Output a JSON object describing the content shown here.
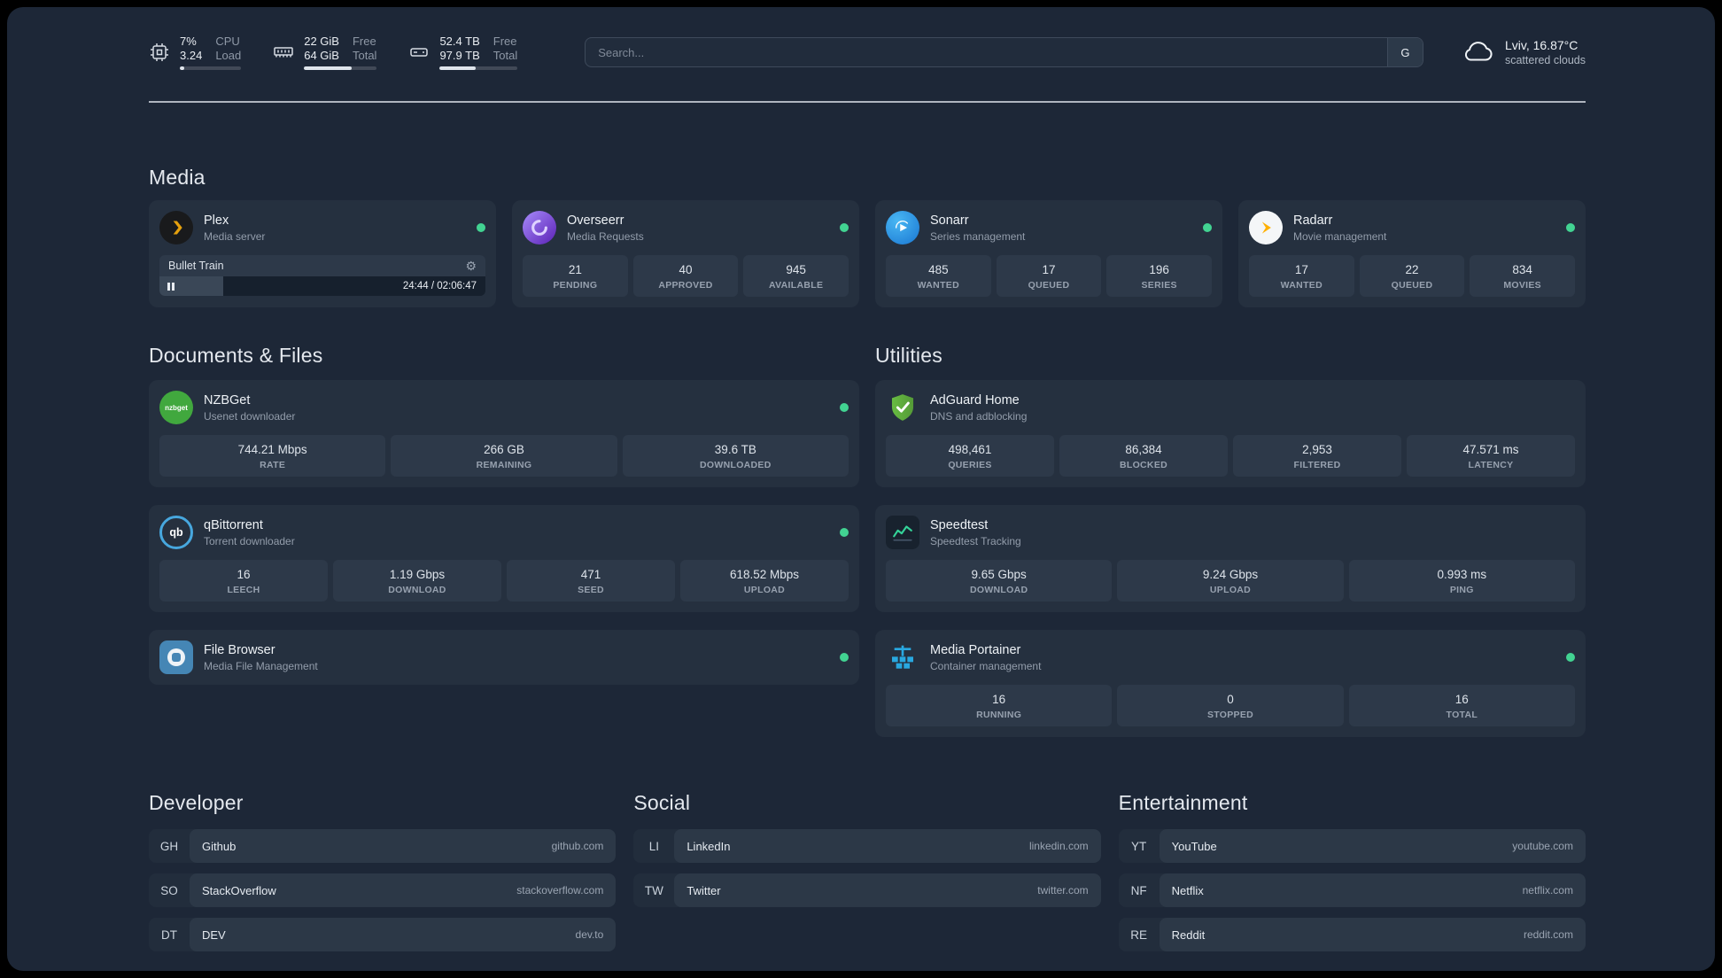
{
  "topbar": {
    "cpu": {
      "value_top": "7%",
      "value_bottom": "3.24",
      "label_top": "CPU",
      "label_bottom": "Load",
      "progress_percent": 7
    },
    "memory": {
      "value_top": "22 GiB",
      "value_bottom": "64 GiB",
      "label_top": "Free",
      "label_bottom": "Total",
      "progress_percent": 66
    },
    "disk": {
      "value_top": "52.4 TB",
      "value_bottom": "97.9 TB",
      "label_top": "Free",
      "label_bottom": "Total",
      "progress_percent": 46
    },
    "search": {
      "placeholder": "Search...",
      "provider_button": "G"
    },
    "weather": {
      "location": "Lviv, 16.87°C",
      "condition": "scattered clouds"
    }
  },
  "media": {
    "title": "Media",
    "plex": {
      "name": "Plex",
      "description": "Media server",
      "now_playing_title": "Bullet Train",
      "now_playing_time": "24:44 / 02:06:47",
      "progress_percent": 19.5
    },
    "overseerr": {
      "name": "Overseerr",
      "description": "Media Requests",
      "stats": [
        {
          "value": "21",
          "label": "PENDING"
        },
        {
          "value": "40",
          "label": "APPROVED"
        },
        {
          "value": "945",
          "label": "AVAILABLE"
        }
      ]
    },
    "sonarr": {
      "name": "Sonarr",
      "description": "Series management",
      "stats": [
        {
          "value": "485",
          "label": "WANTED"
        },
        {
          "value": "17",
          "label": "QUEUED"
        },
        {
          "value": "196",
          "label": "SERIES"
        }
      ]
    },
    "radarr": {
      "name": "Radarr",
      "description": "Movie management",
      "stats": [
        {
          "value": "17",
          "label": "WANTED"
        },
        {
          "value": "22",
          "label": "QUEUED"
        },
        {
          "value": "834",
          "label": "MOVIES"
        }
      ]
    }
  },
  "documents": {
    "title": "Documents & Files",
    "nzbget": {
      "name": "NZBGet",
      "description": "Usenet downloader",
      "icon_text": "nzbget",
      "stats": [
        {
          "value": "744.21 Mbps",
          "label": "RATE"
        },
        {
          "value": "266 GB",
          "label": "REMAINING"
        },
        {
          "value": "39.6 TB",
          "label": "DOWNLOADED"
        }
      ]
    },
    "qbittorrent": {
      "name": "qBittorrent",
      "description": "Torrent downloader",
      "icon_text": "qb",
      "stats": [
        {
          "value": "16",
          "label": "LEECH"
        },
        {
          "value": "1.19 Gbps",
          "label": "DOWNLOAD"
        },
        {
          "value": "471",
          "label": "SEED"
        },
        {
          "value": "618.52 Mbps",
          "label": "UPLOAD"
        }
      ]
    },
    "filebrowser": {
      "name": "File Browser",
      "description": "Media File Management"
    }
  },
  "utilities": {
    "title": "Utilities",
    "adguard": {
      "name": "AdGuard Home",
      "description": "DNS and adblocking",
      "stats": [
        {
          "value": "498,461",
          "label": "QUERIES"
        },
        {
          "value": "86,384",
          "label": "BLOCKED"
        },
        {
          "value": "2,953",
          "label": "FILTERED"
        },
        {
          "value": "47.571 ms",
          "label": "LATENCY"
        }
      ]
    },
    "speedtest": {
      "name": "Speedtest",
      "description": "Speedtest Tracking",
      "stats": [
        {
          "value": "9.65 Gbps",
          "label": "DOWNLOAD"
        },
        {
          "value": "9.24 Gbps",
          "label": "UPLOAD"
        },
        {
          "value": "0.993 ms",
          "label": "PING"
        }
      ]
    },
    "portainer": {
      "name": "Media Portainer",
      "description": "Container management",
      "stats": [
        {
          "value": "16",
          "label": "RUNNING"
        },
        {
          "value": "0",
          "label": "STOPPED"
        },
        {
          "value": "16",
          "label": "TOTAL"
        }
      ]
    }
  },
  "bookmarks": {
    "developer": {
      "title": "Developer",
      "items": [
        {
          "abbr": "GH",
          "name": "Github",
          "url": "github.com"
        },
        {
          "abbr": "SO",
          "name": "StackOverflow",
          "url": "stackoverflow.com"
        },
        {
          "abbr": "DT",
          "name": "DEV",
          "url": "dev.to"
        }
      ]
    },
    "social": {
      "title": "Social",
      "items": [
        {
          "abbr": "LI",
          "name": "LinkedIn",
          "url": "linkedin.com"
        },
        {
          "abbr": "TW",
          "name": "Twitter",
          "url": "twitter.com"
        }
      ]
    },
    "entertainment": {
      "title": "Entertainment",
      "items": [
        {
          "abbr": "YT",
          "name": "YouTube",
          "url": "youtube.com"
        },
        {
          "abbr": "NF",
          "name": "Netflix",
          "url": "netflix.com"
        },
        {
          "abbr": "RE",
          "name": "Reddit",
          "url": "reddit.com"
        }
      ]
    }
  },
  "colors": {
    "status_online": "#42d392",
    "accent_green": "#34d399",
    "plex_amber": "#e5a00d"
  }
}
